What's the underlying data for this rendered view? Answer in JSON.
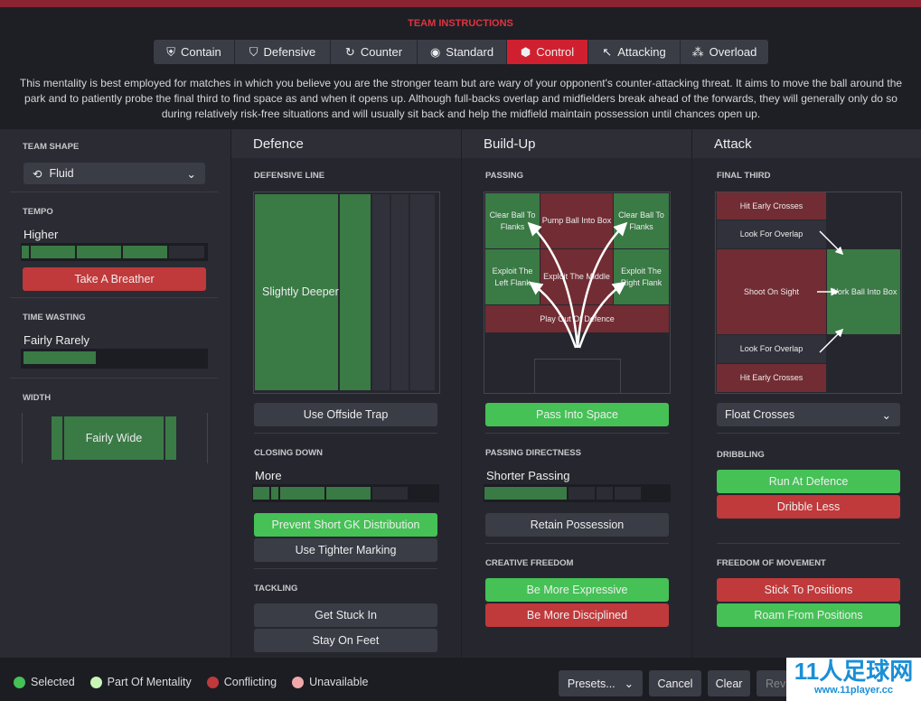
{
  "header": {
    "title": "TEAM INSTRUCTIONS",
    "mentalities": [
      {
        "label": "Contain",
        "icon": "shield-icon"
      },
      {
        "label": "Defensive",
        "icon": "shield-icon"
      },
      {
        "label": "Counter",
        "icon": "counter-icon"
      },
      {
        "label": "Standard",
        "icon": "standard-icon"
      },
      {
        "label": "Control",
        "icon": "control-icon"
      },
      {
        "label": "Attacking",
        "icon": "attacking-icon"
      },
      {
        "label": "Overload",
        "icon": "overload-icon"
      }
    ],
    "selected": "Control",
    "description": "This mentality is best employed for matches in which you believe you are the stronger team but are wary of your opponent's counter-attacking threat. It aims to move the ball around the park and to patiently probe the final third to find space as and when it opens up. Although full-backs overlap and midfielders break ahead of the forwards, they will generally only do so during relatively risk-free situations and will usually sit back and help the midfield maintain possession until chances open up."
  },
  "left": {
    "team_shape_label": "TEAM SHAPE",
    "team_shape": "Fluid",
    "tempo_label": "TEMPO",
    "tempo": "Higher",
    "tempo_level": 0.8,
    "tempo_button": "Take A Breather",
    "time_wasting_label": "TIME WASTING",
    "time_wasting": "Fairly Rarely",
    "time_wasting_level": 0.4,
    "width_label": "WIDTH",
    "width": "Fairly Wide"
  },
  "defence": {
    "title": "Defence",
    "line_label": "DEFENSIVE LINE",
    "line": "Slightly Deeper",
    "offside": "Use Offside Trap",
    "closing_label": "CLOSING DOWN",
    "closing": "More",
    "closing_level": 0.7,
    "prevent_gk": "Prevent Short GK Distribution",
    "tighter": "Use Tighter Marking",
    "tackling_label": "TACKLING",
    "stuck_in": "Get Stuck In",
    "stay_feet": "Stay On Feet"
  },
  "buildup": {
    "title": "Build-Up",
    "passing_label": "PASSING",
    "cells": {
      "clear_left": "Clear Ball To Flanks",
      "pump": "Pump Ball Into Box",
      "clear_right": "Clear Ball To Flanks",
      "exploit_left": "Exploit The Left Flank",
      "exploit_middle": "Exploit The Middle",
      "exploit_right": "Exploit The Right Flank",
      "play_out": "Play Out Of Defence"
    },
    "pass_space": "Pass Into Space",
    "directness_label": "PASSING DIRECTNESS",
    "directness": "Shorter Passing",
    "directness_level": 0.45,
    "retain": "Retain Possession",
    "creative_label": "CREATIVE FREEDOM",
    "expressive": "Be More Expressive",
    "disciplined": "Be More Disciplined"
  },
  "attack": {
    "title": "Attack",
    "final_label": "FINAL THIRD",
    "cells": {
      "hit_top": "Hit Early Crosses",
      "overlap_top": "Look For Overlap",
      "shoot": "Shoot On Sight",
      "work_ball": "Work Ball Into Box",
      "overlap_bottom": "Look For Overlap",
      "hit_bottom": "Hit Early Crosses"
    },
    "crosses": "Float Crosses",
    "dribbling_label": "DRIBBLING",
    "run_at": "Run At Defence",
    "dribble_less": "Dribble Less",
    "freedom_label": "FREEDOM OF MOVEMENT",
    "stick": "Stick To Positions",
    "roam": "Roam From Positions"
  },
  "footer": {
    "legend": [
      {
        "label": "Selected",
        "color": "#45c156"
      },
      {
        "label": "Part Of Mentality",
        "color": "#c9f5b8"
      },
      {
        "label": "Conflicting",
        "color": "#c0393b"
      },
      {
        "label": "Unavailable",
        "color": "#f0a8a8"
      }
    ],
    "presets": "Presets...",
    "cancel": "Cancel",
    "clear": "Clear",
    "revert": "Rev"
  },
  "colors": {
    "accent": "#d0202f",
    "selected": "#45c156",
    "conflicting": "#c0393b",
    "pitch_green": "#3a7a45",
    "pitch_red": "#722c33"
  }
}
